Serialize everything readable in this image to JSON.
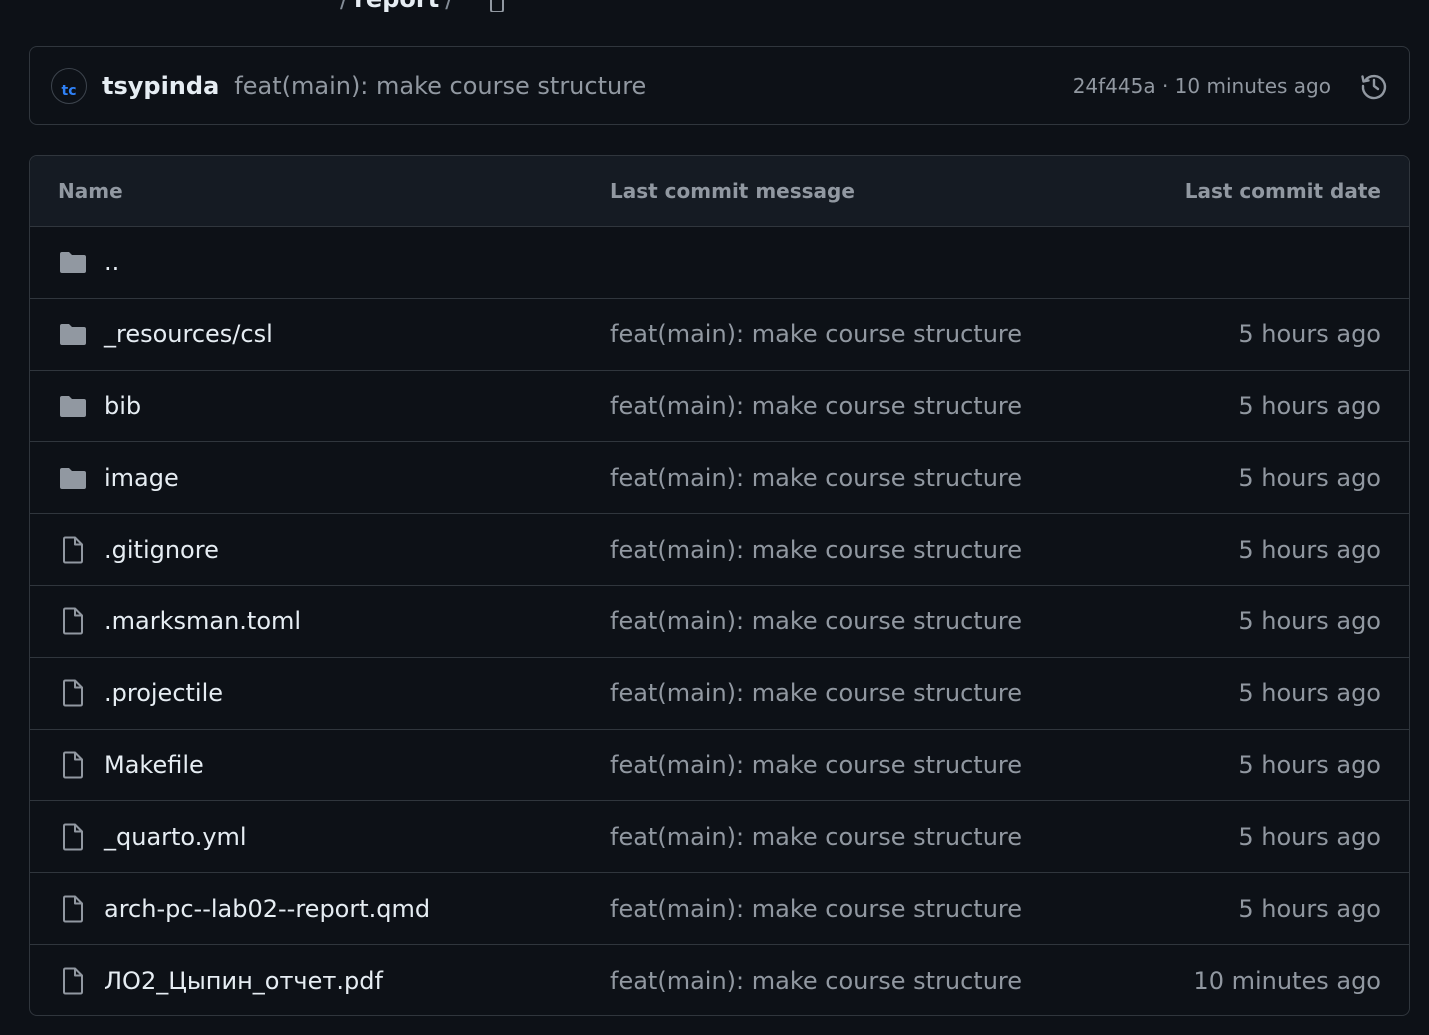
{
  "breadcrumb": {
    "folder": "report",
    "separator": "/"
  },
  "latest_commit": {
    "avatar_text": "tc",
    "author": "tsypinda",
    "message": "feat(main): make course structure",
    "meta": "24f445a · 10 minutes ago",
    "history_icon": "history-icon"
  },
  "table": {
    "headers": {
      "name": "Name",
      "message": "Last commit message",
      "date": "Last commit date"
    },
    "rows": [
      {
        "type": "folder",
        "icon": "folder-icon",
        "name": "..",
        "message": "",
        "date": ""
      },
      {
        "type": "folder",
        "icon": "folder-icon",
        "name": "_resources/csl",
        "message": "feat(main): make course structure",
        "date": "5 hours ago"
      },
      {
        "type": "folder",
        "icon": "folder-icon",
        "name": "bib",
        "message": "feat(main): make course structure",
        "date": "5 hours ago"
      },
      {
        "type": "folder",
        "icon": "folder-icon",
        "name": "image",
        "message": "feat(main): make course structure",
        "date": "5 hours ago"
      },
      {
        "type": "file",
        "icon": "file-icon",
        "name": ".gitignore",
        "message": "feat(main): make course structure",
        "date": "5 hours ago"
      },
      {
        "type": "file",
        "icon": "file-icon",
        "name": ".marksman.toml",
        "message": "feat(main): make course structure",
        "date": "5 hours ago"
      },
      {
        "type": "file",
        "icon": "file-icon",
        "name": ".projectile",
        "message": "feat(main): make course structure",
        "date": "5 hours ago"
      },
      {
        "type": "file",
        "icon": "file-icon",
        "name": "Makefile",
        "message": "feat(main): make course structure",
        "date": "5 hours ago"
      },
      {
        "type": "file",
        "icon": "file-icon",
        "name": "_quarto.yml",
        "message": "feat(main): make course structure",
        "date": "5 hours ago"
      },
      {
        "type": "file",
        "icon": "file-icon",
        "name": "arch-pc--lab02--report.qmd",
        "message": "feat(main): make course structure",
        "date": "5 hours ago"
      },
      {
        "type": "file",
        "icon": "file-icon",
        "name": "ЛО2_Цыпин_отчет.pdf",
        "message": "feat(main): make course structure",
        "date": "10 minutes ago"
      }
    ]
  },
  "colors": {
    "background": "#0d1117",
    "border": "#30363d",
    "header_bg": "#151b23",
    "text_primary": "#e6edf3",
    "text_muted": "#9198a1",
    "folder_icon": "#9198a1"
  }
}
